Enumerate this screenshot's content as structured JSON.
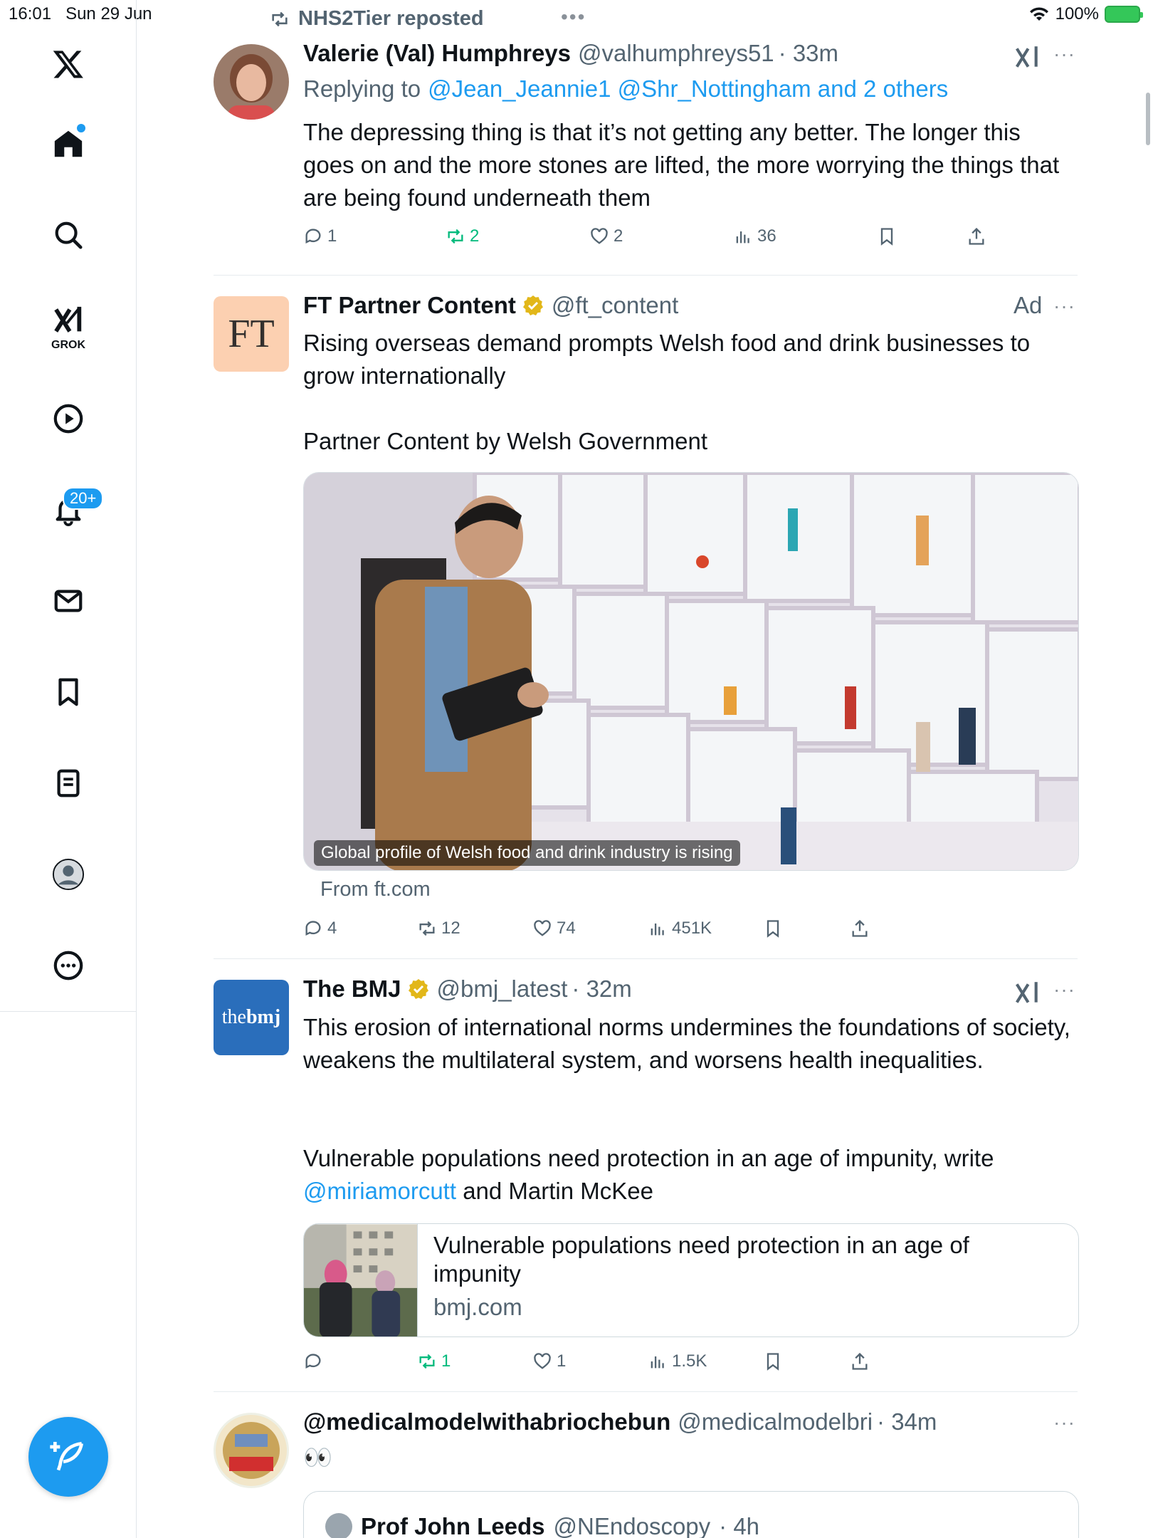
{
  "status_bar": {
    "time": "16:01",
    "date": "Sun 29 Jun",
    "battery": "100%"
  },
  "nav": {
    "grok_label": "GROK",
    "notifications_badge": "20+"
  },
  "tweets": [
    {
      "repost_by": "NHS2Tier reposted",
      "name": "Valerie (Val) Humphreys",
      "handle": "@valhumphreys51",
      "time": "· 33m",
      "replying_prefix": "Replying to",
      "replying_to": "@Jean_Jeannie1 @Shr_Nottingham and 2 others",
      "text": "The depressing thing is that it’s not getting any better. The longer this goes on and the more stones are lifted, the more worrying the things that are being found underneath them",
      "replies": "1",
      "reposts": "2",
      "likes": "2",
      "views": "36"
    },
    {
      "avatar_text": "FT",
      "name": "FT Partner Content",
      "handle": "@ft_content",
      "ad_label": "Ad",
      "text_line1": "Rising overseas demand prompts Welsh food and drink businesses to grow internationally",
      "text_line2": "Partner Content by Welsh Government",
      "media_caption": "Global profile of Welsh food and drink industry is rising",
      "from": "From ft.com",
      "replies": "4",
      "reposts": "12",
      "likes": "74",
      "views": "451K"
    },
    {
      "avatar_text_a": "the",
      "avatar_text_b": "bmj",
      "name": "The BMJ",
      "handle": "@bmj_latest",
      "time": "· 32m",
      "text_para1": "This erosion of international norms undermines the foundations of society, weakens the multilateral system, and worsens health inequalities.",
      "text_para2_a": "Vulnerable populations need protection in an age of impunity, write",
      "text_mention": "@miriamorcutt",
      "text_para2_b": "and Martin McKee",
      "card_title": "Vulnerable populations need protection in an age of impunity",
      "card_domain": "bmj.com",
      "replies": "",
      "reposts": "1",
      "likes": "1",
      "views": "1.5K"
    },
    {
      "name": "@medicalmodelwithabriochebun",
      "handle": "@medicalmodelbri",
      "time": "· 34m",
      "text": "👀",
      "quote_name": "Prof John Leeds",
      "quote_handle": "@NEndoscopy",
      "quote_time": "· 4h"
    }
  ]
}
